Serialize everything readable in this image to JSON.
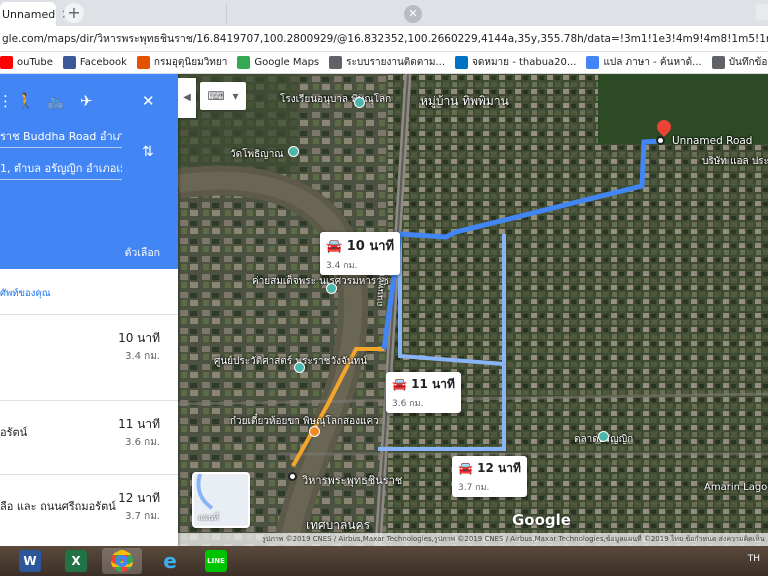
{
  "browser": {
    "tab_title": "Unnamed",
    "tab_close": "×",
    "new_tab": "+",
    "url_visible": "gle.com/maps/dir/วิหารพระพุทธชินราช/16.8419707,100.2800929/@16.832352,100.2660229,4144a,35y,355.78h/data=!3m1!1e3!4m9!4m8!1m5!1m1!1s0x30df97e1b..."
  },
  "bookmarks": [
    {
      "label": "ouTube",
      "icon": "youtube-icon",
      "color": "#ff0000"
    },
    {
      "label": "Facebook",
      "icon": "facebook-icon",
      "color": "#3b5998"
    },
    {
      "label": "กรมอุตุนิยมวิทยา",
      "icon": "tmd-icon",
      "color": "#e65100"
    },
    {
      "label": "Google Maps",
      "icon": "maps-icon",
      "color": "#34a853"
    },
    {
      "label": "ระบบรายงานติดตาม...",
      "icon": "globe-icon",
      "color": "#5f6368"
    },
    {
      "label": "จดหมาย - thabua20...",
      "icon": "outlook-icon",
      "color": "#0072c6"
    },
    {
      "label": "แปล ภาษา - ค้นหาด้...",
      "icon": "google-icon",
      "color": "#4285f4"
    },
    {
      "label": "บันทึกข้อมูลการเกษ...",
      "icon": "globe-icon",
      "color": "#5f6368"
    }
  ],
  "directions": {
    "origin": "ราช Buddha Road อำเภ",
    "destination": "1, ตำบล อรัญญิก อำเภอเมื",
    "options_label": "ตัวเลือก",
    "suggest_label": "ศัพท์ของคุณ",
    "routes": [
      {
        "name": "",
        "time": "10 นาที",
        "distance": "3.4 กม."
      },
      {
        "name": "อรัตน์",
        "time": "11 นาที",
        "distance": "3.6 กม."
      },
      {
        "name": "ลือ และ ถนนศรีถมอรัตน์",
        "time": "12 นาที",
        "distance": "3.7 กม."
      }
    ]
  },
  "map": {
    "callouts": [
      {
        "time": "10 นาที",
        "distance": "3.4 กม."
      },
      {
        "time": "11 นาที",
        "distance": "3.6 กม."
      },
      {
        "time": "12 นาที",
        "distance": "3.7 กม."
      }
    ],
    "destination_label": "Unnamed Road",
    "origin_label": "วิหารพระพุทธชินราช",
    "place_labels": [
      "โรงเรียนอนุบาล พิษณุโลก",
      "หมู่บ้าน ทิพพิมาน",
      "วัดโพธิญาณ",
      "ค่ายสมเด็จพระ นเรศวรมหาราช",
      "ศูนย์ประวัติศาสตร์ พระราชวังจันทน์",
      "ก๋วยเตี๋ยวห้อยขา พิษณุโลกสองแคว",
      "บริษัท แอล ประกันภัย จำ",
      "ตลาดอรัญญิก",
      "Amarin Lagoo",
      "เทศบาลนคร"
    ],
    "road_label": "ถนนพุทธ",
    "thumbnail_label": "แผนที่",
    "google_logo": "Google",
    "attribution": "รูปภาพ ©2019 CNES / Airbus,Maxar Technologies,รูปภาพ ©2019 CNES / Airbus,Maxar Technologies,ข้อมูลแผนที่ ©2019    ไทย    ข้อกำหนด    ส่งความคิดเห็น",
    "colors": {
      "selected_route": "#4285f4",
      "alt_route": "#8ab4f8",
      "walk_segment": "#f4a62a"
    }
  },
  "taskbar": {
    "apps": [
      "word-icon",
      "excel-icon",
      "chrome-icon",
      "ie-icon",
      "line-icon"
    ],
    "lang": "TH"
  }
}
